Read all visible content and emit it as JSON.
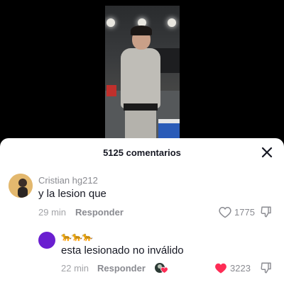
{
  "header": {
    "comment_count_label": "5125 comentarios"
  },
  "comments": [
    {
      "username": "Cristian hg212",
      "text": "y la lesion que",
      "time": "29 min",
      "reply_label": "Responder",
      "likes": "1775",
      "liked": false
    },
    {
      "username": "🐆🐆🐆",
      "text": "esta lesionado no inválido",
      "time": "22 min",
      "reply_label": "Responder",
      "likes": "3223",
      "liked": true,
      "creator_liked": true
    }
  ],
  "colors": {
    "like_active": "#fe2c55",
    "reply_avatar": "#6a1fd0"
  }
}
